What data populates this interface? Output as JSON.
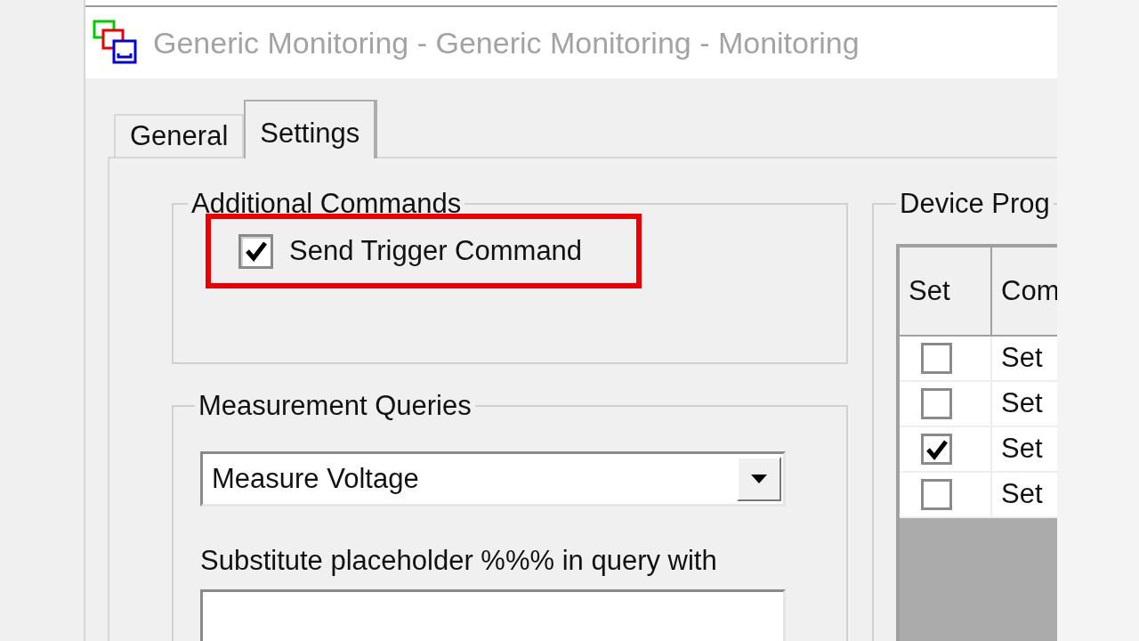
{
  "window": {
    "title": "Generic Monitoring - Generic Monitoring - Monitoring"
  },
  "tabs": [
    {
      "label": "General",
      "selected": false
    },
    {
      "label": "Settings",
      "selected": true
    }
  ],
  "additional_commands": {
    "title": "Additional Commands",
    "checkbox": {
      "label": "Send Trigger Command",
      "checked": true,
      "highlighted": true
    }
  },
  "measurement_queries": {
    "title": "Measurement Queries",
    "dropdown": {
      "value": "Measure Voltage"
    },
    "substitute_label": "Substitute placeholder %%% in query with"
  },
  "device_programming": {
    "title": "Device Prog",
    "table": {
      "columns": [
        "Set",
        "Com"
      ],
      "rows": [
        {
          "set": false,
          "command": "Set"
        },
        {
          "set": false,
          "command": "Set"
        },
        {
          "set": true,
          "command": "Set"
        },
        {
          "set": false,
          "command": "Set"
        }
      ]
    }
  }
}
